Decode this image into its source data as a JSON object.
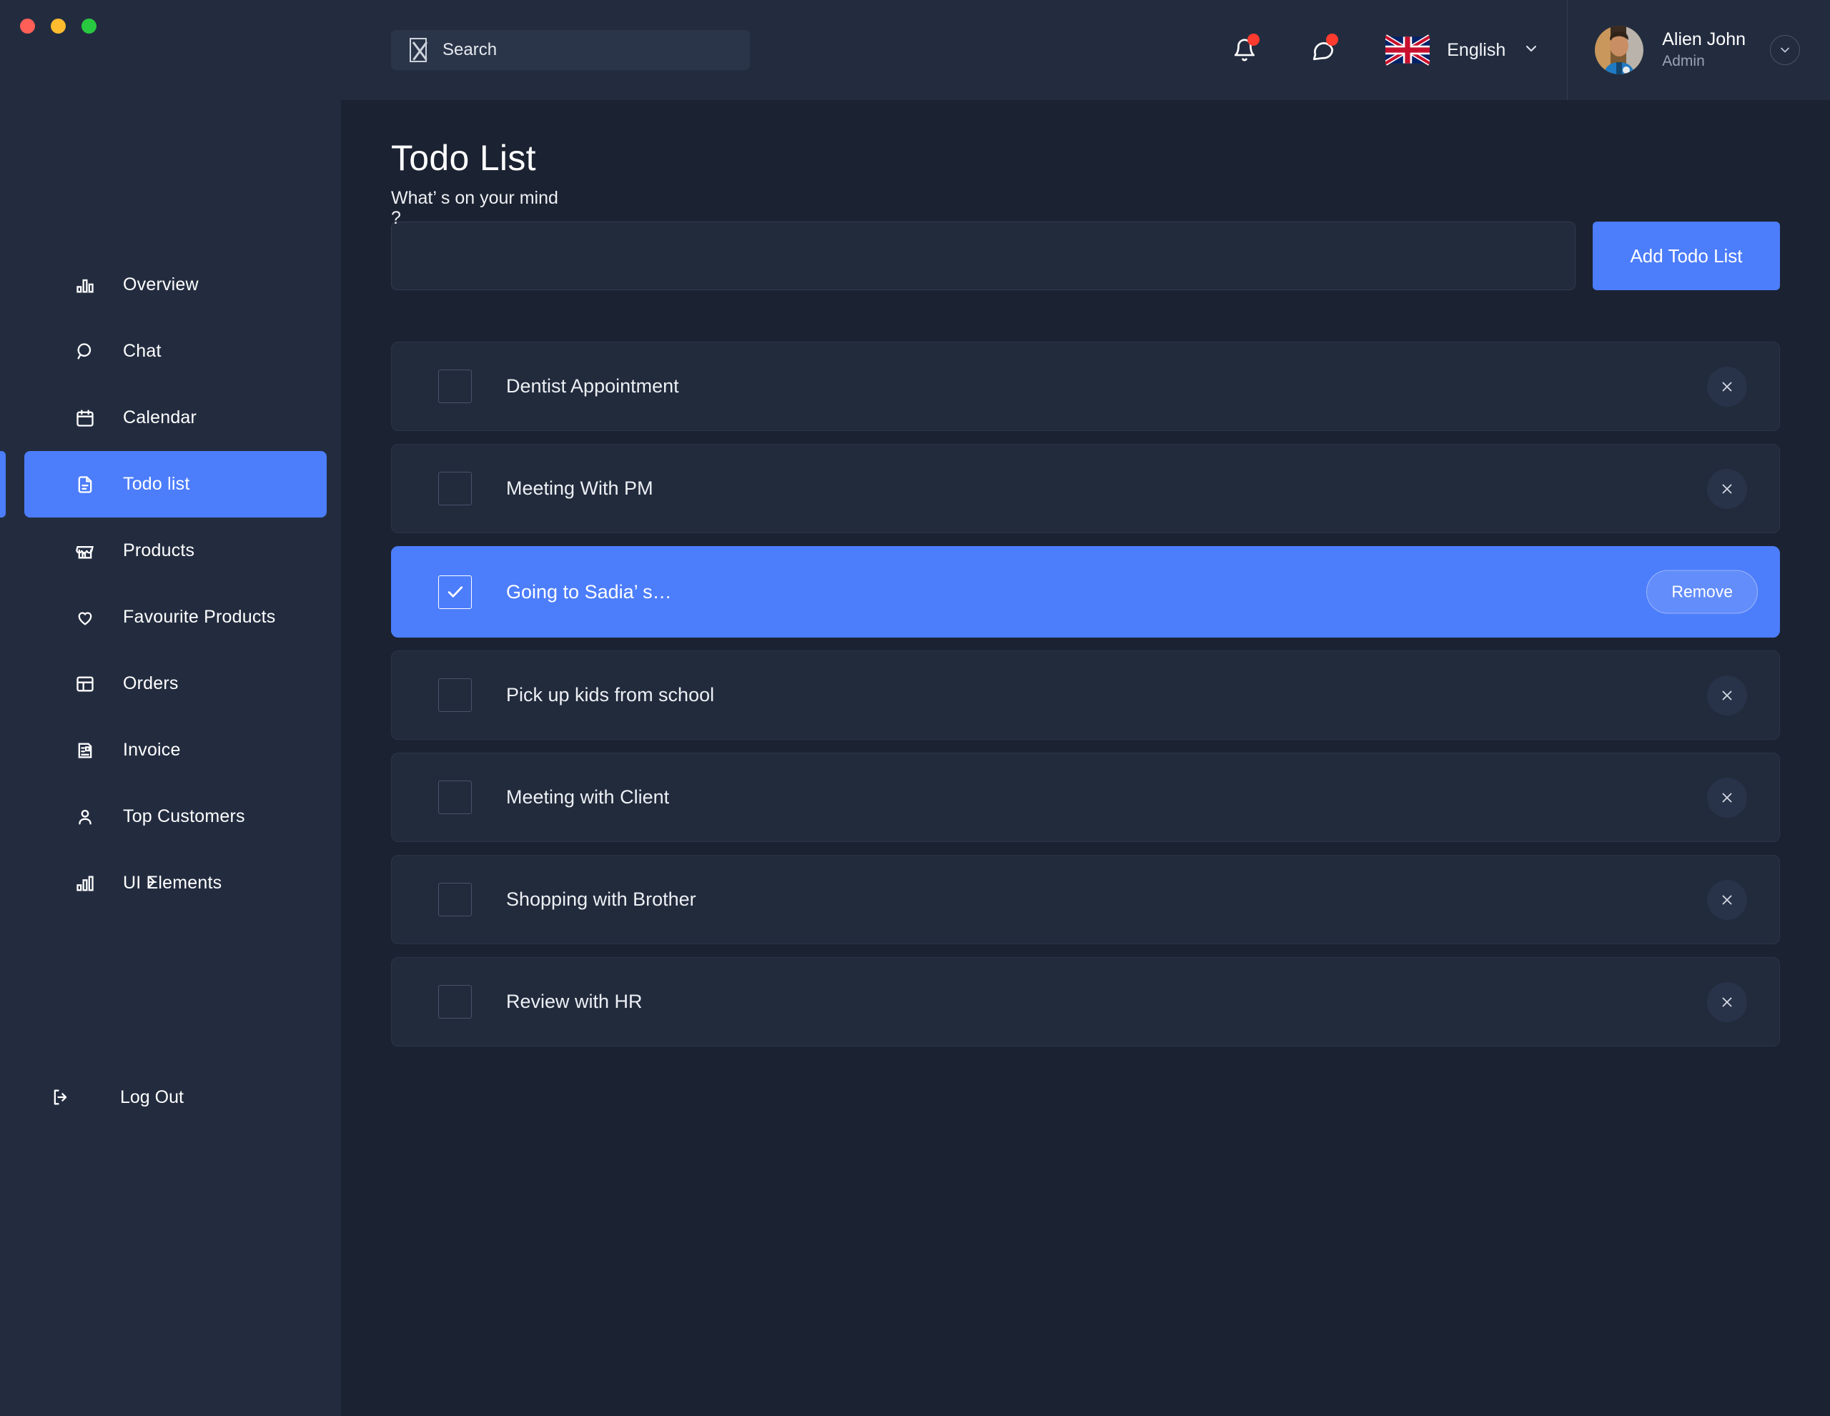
{
  "window": {
    "dots": [
      "close",
      "minimize",
      "maximize"
    ]
  },
  "search": {
    "placeholder": "Search",
    "icon": "missing-glyph-box-icon"
  },
  "topbar": {
    "notification_icon": "bell-icon",
    "message_icon": "chat-bubble-icon",
    "language": "English",
    "language_flag": "uk-flag-icon",
    "language_caret": "chevron-down-icon",
    "profile": {
      "name": "Alien John",
      "role": "Admin",
      "caret": "chevron-down-icon"
    }
  },
  "sidebar": {
    "items": [
      {
        "label": "Overview",
        "icon": "bar-chart-icon",
        "active": false
      },
      {
        "label": "Chat",
        "icon": "search-circle-icon",
        "active": false
      },
      {
        "label": "Calendar",
        "icon": "calendar-icon",
        "active": false
      },
      {
        "label": "Todo list",
        "icon": "document-icon",
        "active": true
      },
      {
        "label": "Products",
        "icon": "store-icon",
        "active": false
      },
      {
        "label": "Favourite Products",
        "icon": "heart-icon",
        "active": false
      },
      {
        "label": "Orders",
        "icon": "layout-icon",
        "active": false
      },
      {
        "label": "Invoice",
        "icon": "invoice-icon",
        "active": false
      },
      {
        "label": "Top Customers",
        "icon": "user-icon",
        "active": false
      },
      {
        "label": "UI Elements",
        "icon": "bar-chart-icon",
        "active": false,
        "chevron": "chevron-right-icon"
      }
    ],
    "logout": {
      "label": "Log Out",
      "icon": "logout-icon"
    }
  },
  "main": {
    "title": "Todo List",
    "compose": {
      "label": "What’ s on your mind ?",
      "input_value": "",
      "add_button": "Add Todo List"
    },
    "todos": [
      {
        "text": "Dentist Appointment",
        "checked": false,
        "action": "×",
        "selected": false
      },
      {
        "text": "Meeting With PM",
        "checked": false,
        "action": "×",
        "selected": false
      },
      {
        "text": "Going to Sadia’ s…",
        "checked": true,
        "action": "Remove",
        "selected": true
      },
      {
        "text": "Pick up kids from school",
        "checked": false,
        "action": "×",
        "selected": false
      },
      {
        "text": "Meeting with Client",
        "checked": false,
        "action": "×",
        "selected": false
      },
      {
        "text": "Shopping with Brother",
        "checked": false,
        "action": "×",
        "selected": false
      },
      {
        "text": "Review with HR",
        "checked": false,
        "action": "×",
        "selected": false
      }
    ]
  },
  "colors": {
    "accent": "#4c7dfb",
    "sidebar_bg": "#232c3f",
    "main_bg": "#1b2231",
    "card_bg": "#222b3c",
    "badge": "#ff3b30"
  }
}
